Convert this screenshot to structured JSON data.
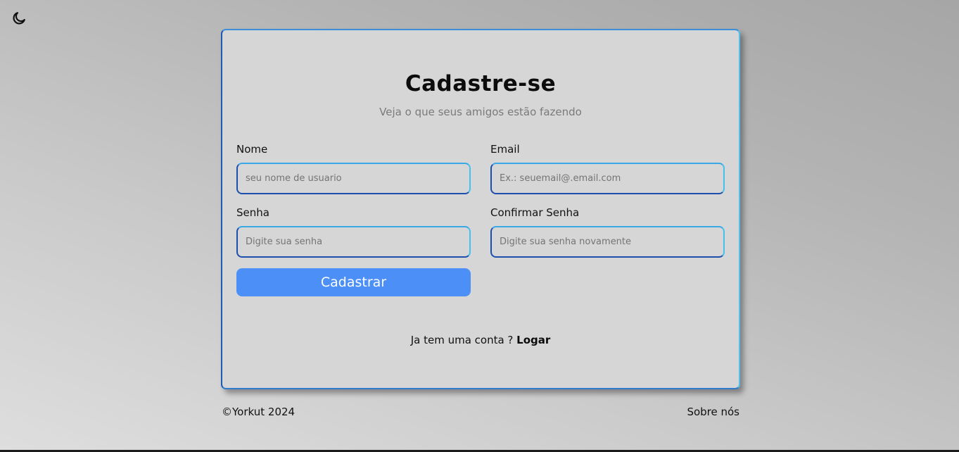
{
  "theme_toggle": {
    "icon": "moon-icon"
  },
  "form": {
    "title": "Cadastre-se",
    "subtitle": "Veja o que seus amigos estão fazendo",
    "fields": {
      "nome": {
        "label": "Nome",
        "value": "",
        "placeholder": "seu nome de usuario"
      },
      "email": {
        "label": "Email",
        "value": "",
        "placeholder": "Ex.: seuemail@.email.com"
      },
      "senha": {
        "label": "Senha",
        "value": "",
        "placeholder": "Digite sua senha"
      },
      "confirmar": {
        "label": "Confirmar Senha",
        "value": "",
        "placeholder": "Digite sua senha novamente"
      }
    },
    "submit_label": "Cadastrar",
    "login_prompt": "Ja tem uma conta ? ",
    "login_link": "Logar"
  },
  "footer": {
    "copyright": "©Yorkut 2024",
    "about": "Sobre nós"
  },
  "colors": {
    "accent": "#4b8ff7",
    "card_background": "#d6d6d6",
    "border_dark": "#1d4fae",
    "border_light": "#45c0f0"
  }
}
